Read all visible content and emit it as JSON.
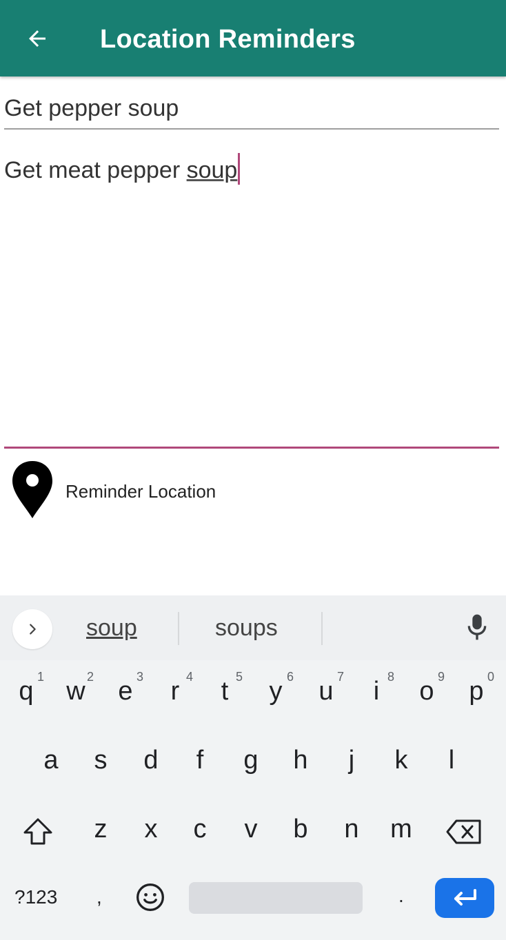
{
  "app_bar": {
    "title": "Location Reminders",
    "back_icon": "arrow-left-icon"
  },
  "form": {
    "title_value": "Get pepper soup",
    "description_prefix": "Get meat pepper ",
    "description_suggest": "soup",
    "location_label": "Reminder Location",
    "location_icon": "map-pin-icon"
  },
  "keyboard": {
    "suggestions": [
      "soup",
      "soups"
    ],
    "row1": [
      {
        "k": "q",
        "h": "1"
      },
      {
        "k": "w",
        "h": "2"
      },
      {
        "k": "e",
        "h": "3"
      },
      {
        "k": "r",
        "h": "4"
      },
      {
        "k": "t",
        "h": "5"
      },
      {
        "k": "y",
        "h": "6"
      },
      {
        "k": "u",
        "h": "7"
      },
      {
        "k": "i",
        "h": "8"
      },
      {
        "k": "o",
        "h": "9"
      },
      {
        "k": "p",
        "h": "0"
      }
    ],
    "row2": [
      "a",
      "s",
      "d",
      "f",
      "g",
      "h",
      "j",
      "k",
      "l"
    ],
    "row3": [
      "z",
      "x",
      "c",
      "v",
      "b",
      "n",
      "m"
    ],
    "symbols_key": "?123",
    "comma_key": ",",
    "period_key": "."
  },
  "colors": {
    "app_bar": "#187f72",
    "accent": "#b0487a",
    "enter_key": "#1a73e8"
  }
}
